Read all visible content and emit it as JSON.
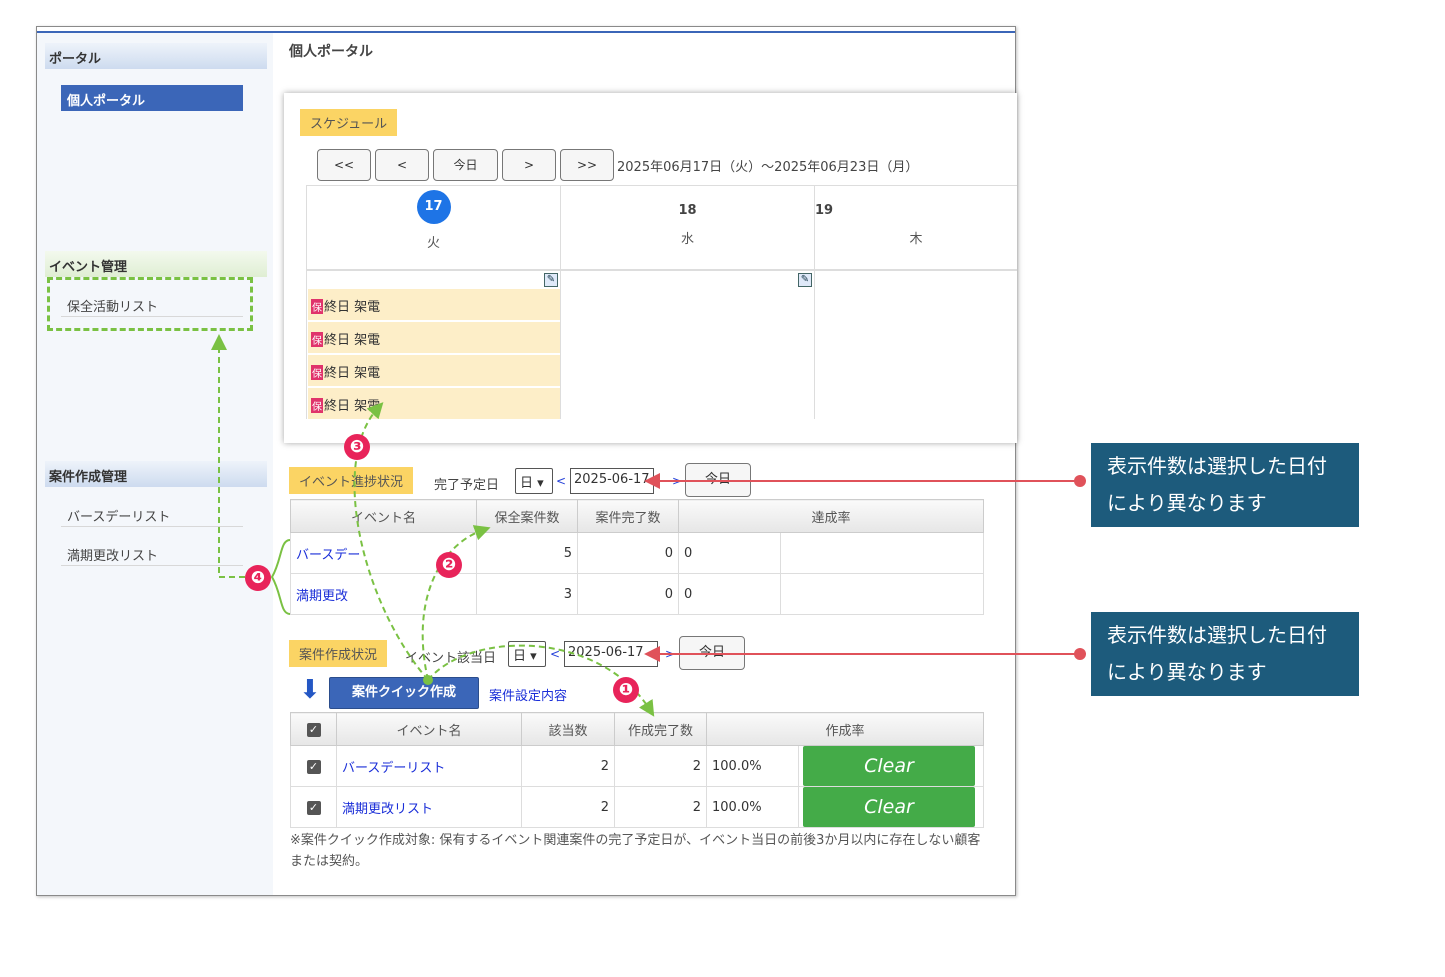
{
  "sidebar": {
    "portal_header": "ポータル",
    "personal_portal": "個人ポータル",
    "event_header": "イベント管理",
    "event_items": [
      "保全活動リスト"
    ],
    "case_header": "案件作成管理",
    "case_items": [
      "バースデーリスト",
      "満期更改リスト"
    ]
  },
  "main": {
    "title": "個人ポータル"
  },
  "schedule": {
    "tag": "スケジュール",
    "nav": [
      "<<",
      "<",
      "今日",
      ">",
      ">>"
    ],
    "range": "2025年06月17日（火）～2025年06月23日（月）",
    "days": [
      {
        "num": "17",
        "name": "火",
        "today": true
      },
      {
        "num": "18",
        "name": "水",
        "today": false
      },
      {
        "num": "19",
        "name": "木",
        "today": false
      }
    ],
    "event_badge": "保",
    "events": [
      "終日 架電",
      "終日 架電",
      "終日 架電",
      "終日 架電"
    ]
  },
  "event_progress": {
    "tag": "イベント進捗状況",
    "label": "完了予定日",
    "unit": "日",
    "date": "2025-06-17",
    "prev": "<",
    "next": ">",
    "today": "今日",
    "headers": [
      "イベント名",
      "保全案件数",
      "案件完了数",
      "達成率"
    ],
    "rows": [
      {
        "name": "バースデー",
        "count": "5",
        "done": "0",
        "rate": "0"
      },
      {
        "name": "満期更改",
        "count": "3",
        "done": "0",
        "rate": "0"
      }
    ]
  },
  "case_status": {
    "tag": "案件作成状況",
    "label": "イベント該当日",
    "unit": "日",
    "date": "2025-06-17",
    "prev": "<",
    "next": ">",
    "today": "今日",
    "quick_button": "案件クイック作成",
    "settings_link": "案件設定内容",
    "headers": [
      "イベント名",
      "該当数",
      "作成完了数",
      "作成率"
    ],
    "rows": [
      {
        "name": "バースデーリスト",
        "count": "2",
        "done": "2",
        "rate": "100.0%",
        "status": "Clear"
      },
      {
        "name": "満期更改リスト",
        "count": "2",
        "done": "2",
        "rate": "100.0%",
        "status": "Clear"
      }
    ],
    "note": "※案件クイック作成対象: 保有するイベント関連案件の完了予定日が、イベント当日の前後3か月以内に存在しない顧客または契約。"
  },
  "callouts": [
    "表示件数は選択した日付により異なります",
    "表示件数は選択した日付により異なります"
  ],
  "markers": [
    "❶",
    "❷",
    "❸",
    "❹"
  ],
  "colors": {
    "accent": "#3b66b8",
    "clear": "#44ab48",
    "tag": "#fbd464",
    "callout": "#1d5b7c",
    "marker": "#e8245a",
    "annotation_green": "#7ac143",
    "annotation_red": "#e0525a"
  }
}
